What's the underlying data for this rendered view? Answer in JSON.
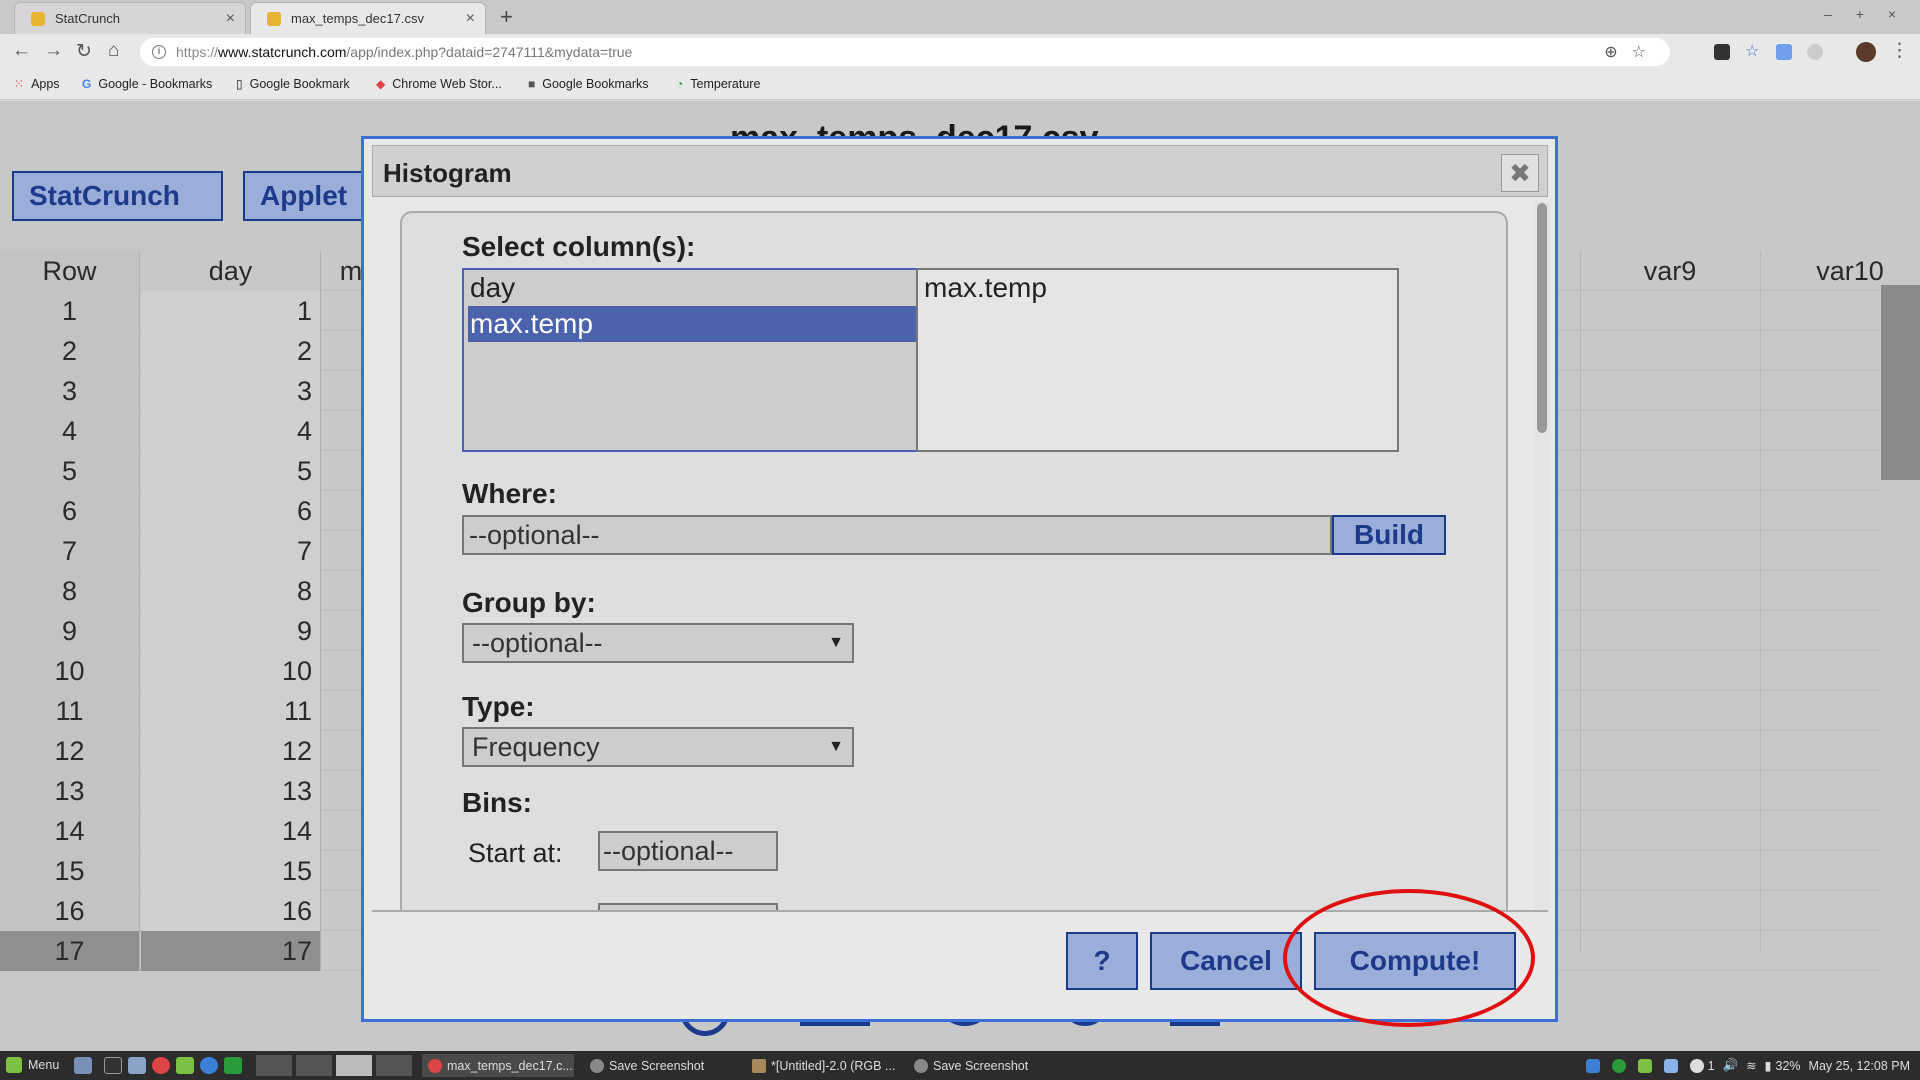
{
  "browser": {
    "tabs": [
      {
        "title": "StatCrunch"
      },
      {
        "title": "max_temps_dec17.csv"
      }
    ],
    "new_tab": "+",
    "url": {
      "scheme": "https://",
      "host": "www.statcrunch.com",
      "path": "/app/index.php?dataid=2747111&mydata=true"
    },
    "bookmarks": [
      "Apps",
      "Google - Bookmarks",
      "Google Bookmark",
      "Chrome Web Stor...",
      "Google Bookmarks",
      "Temperature"
    ]
  },
  "page": {
    "title": "max_temps_dec17.csv",
    "menu_buttons": [
      "StatCrunch",
      "Applet"
    ],
    "columns": {
      "row": "Row",
      "day": "day",
      "partial": "m",
      "var9": "var9",
      "var10": "var10"
    },
    "rows": [
      {
        "row": "1",
        "day": "1"
      },
      {
        "row": "2",
        "day": "2"
      },
      {
        "row": "3",
        "day": "3"
      },
      {
        "row": "4",
        "day": "4"
      },
      {
        "row": "5",
        "day": "5"
      },
      {
        "row": "6",
        "day": "6"
      },
      {
        "row": "7",
        "day": "7"
      },
      {
        "row": "8",
        "day": "8"
      },
      {
        "row": "9",
        "day": "9"
      },
      {
        "row": "10",
        "day": "10"
      },
      {
        "row": "11",
        "day": "11"
      },
      {
        "row": "12",
        "day": "12"
      },
      {
        "row": "13",
        "day": "13"
      },
      {
        "row": "14",
        "day": "14"
      },
      {
        "row": "15",
        "day": "15"
      },
      {
        "row": "16",
        "day": "16"
      },
      {
        "row": "17",
        "day": "17"
      }
    ]
  },
  "dialog": {
    "title": "Histogram",
    "close": "✖",
    "select_columns_label": "Select column(s):",
    "available_columns": [
      "day",
      "max.temp"
    ],
    "selected_columns": [
      "max.temp"
    ],
    "where_label": "Where:",
    "where_placeholder": "--optional--",
    "build_label": "Build",
    "group_by_label": "Group by:",
    "group_by_value": "--optional--",
    "type_label": "Type:",
    "type_value": "Frequency",
    "bins_label": "Bins:",
    "start_at_label": "Start at:",
    "start_at_placeholder": "--optional--",
    "help_label": "?",
    "cancel_label": "Cancel",
    "compute_label": "Compute!"
  },
  "taskbar": {
    "menu_label": "Menu",
    "tasks": [
      "max_temps_dec17.c...",
      "Save Screenshot",
      "*[Untitled]-2.0 (RGB ...",
      "Save Screenshot"
    ],
    "tray_status": "1",
    "battery": "32%",
    "clock": "May 25, 12:08 PM"
  }
}
